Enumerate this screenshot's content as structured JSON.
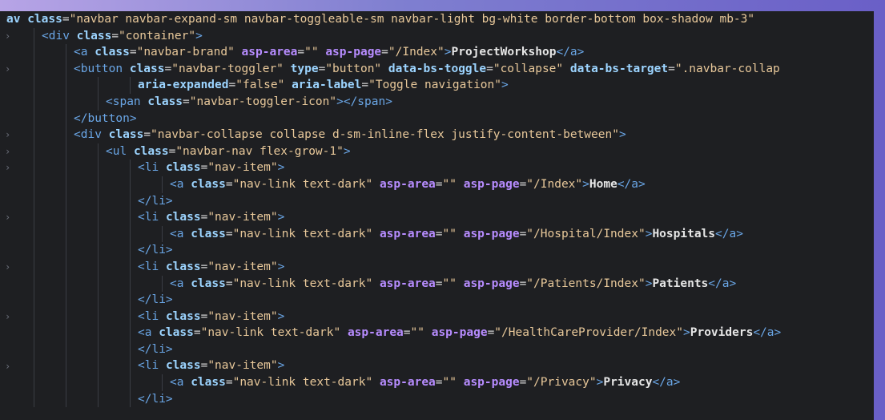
{
  "lines": [
    {
      "indent": 0,
      "text": "av class=\"navbar navbar-expand-sm navbar-toggleable-sm navbar-light bg-white border-bottom box-shadow mb-3\""
    },
    {
      "indent": 1,
      "text": "<div class=\"container\">"
    },
    {
      "indent": 2,
      "text": "<a class=\"navbar-brand\" asp-area=\"\" asp-page=\"/Index\">ProjectWorkshop</a>"
    },
    {
      "indent": 2,
      "text": "<button class=\"navbar-toggler\" type=\"button\" data-bs-toggle=\"collapse\" data-bs-target=\".navbar-collap"
    },
    {
      "indent": 4,
      "text": "aria-expanded=\"false\" aria-label=\"Toggle navigation\">"
    },
    {
      "indent": 3,
      "text": "<span class=\"navbar-toggler-icon\"></span>"
    },
    {
      "indent": 2,
      "text": "</button>"
    },
    {
      "indent": 2,
      "text": "<div class=\"navbar-collapse collapse d-sm-inline-flex justify-content-between\">"
    },
    {
      "indent": 3,
      "text": "<ul class=\"navbar-nav flex-grow-1\">"
    },
    {
      "indent": 4,
      "text": "<li class=\"nav-item\">"
    },
    {
      "indent": 5,
      "text": "<a class=\"nav-link text-dark\" asp-area=\"\" asp-page=\"/Index\">Home</a>"
    },
    {
      "indent": 4,
      "text": "</li>"
    },
    {
      "indent": 4,
      "text": "<li class=\"nav-item\">"
    },
    {
      "indent": 5,
      "text": "<a class=\"nav-link text-dark\" asp-area=\"\" asp-page=\"/Hospital/Index\">Hospitals</a>"
    },
    {
      "indent": 4,
      "text": "</li>"
    },
    {
      "indent": 4,
      "text": "<li class=\"nav-item\">"
    },
    {
      "indent": 5,
      "text": "<a class=\"nav-link text-dark\" asp-area=\"\" asp-page=\"/Patients/Index\">Patients</a>"
    },
    {
      "indent": 4,
      "text": "</li>"
    },
    {
      "indent": 4,
      "text": "<li class=\"nav-item\">"
    },
    {
      "indent": 4,
      "text": "<a class=\"nav-link text-dark\" asp-area=\"\" asp-page=\"/HealthCareProvider/Index\">Providers</a>"
    },
    {
      "indent": 4,
      "text": "</li>"
    },
    {
      "indent": 4,
      "text": "<li class=\"nav-item\">"
    },
    {
      "indent": 5,
      "text": "<a class=\"nav-link text-dark\" asp-area=\"\" asp-page=\"/Privacy\">Privacy</a>"
    },
    {
      "indent": 4,
      "text": "</li>"
    }
  ],
  "colors": {
    "tag": "#6aa6e6",
    "attr": "#9cd4ff",
    "string": "#e8c89a",
    "asp": "#b78cff",
    "text": "#e6e6e6",
    "background": "#1e1f22"
  }
}
